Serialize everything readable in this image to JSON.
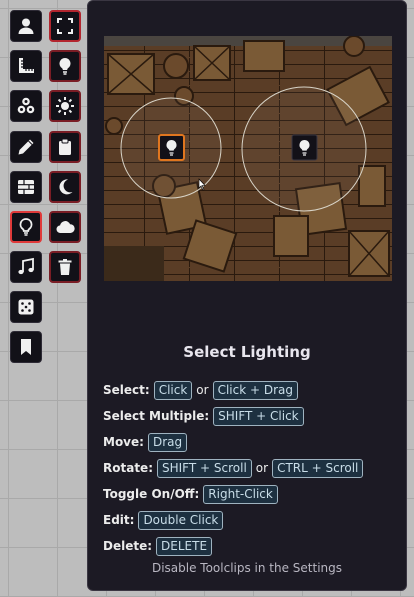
{
  "toolbar": {
    "buttons": [
      {
        "name": "token-tool",
        "icon": "user-icon"
      },
      {
        "name": "fullscreen-tool",
        "icon": "fullscreen-icon"
      },
      {
        "name": "measure-tool",
        "icon": "ruler-icon"
      },
      {
        "name": "light-sub-tool",
        "icon": "lightbulb-icon"
      },
      {
        "name": "tiles-tool",
        "icon": "shapes-icon"
      },
      {
        "name": "light-settings-tool",
        "icon": "sun-icon"
      },
      {
        "name": "drawing-tool",
        "icon": "pencil-icon"
      },
      {
        "name": "notes-tool",
        "icon": "clipboard-icon"
      },
      {
        "name": "walls-tool",
        "icon": "brick-icon"
      },
      {
        "name": "night-tool",
        "icon": "moon-icon"
      },
      {
        "name": "lighting-tool",
        "icon": "lightbulb-icon"
      },
      {
        "name": "weather-tool",
        "icon": "cloud-icon"
      },
      {
        "name": "sounds-tool",
        "icon": "music-icon"
      },
      {
        "name": "clear-tool",
        "icon": "trash-icon"
      },
      {
        "name": "tables-tool",
        "icon": "dice-icon"
      },
      {
        "name": "journal-tool",
        "icon": "bookmark-icon"
      }
    ]
  },
  "tooltip": {
    "title": "Select Lighting",
    "rows": [
      {
        "label": "Select:",
        "keys": [
          "Click",
          "Click + Drag"
        ],
        "sep": "or"
      },
      {
        "label": "Select Multiple:",
        "keys": [
          "SHIFT + Click"
        ]
      },
      {
        "label": "Move:",
        "keys": [
          "Drag"
        ]
      },
      {
        "label": "Rotate:",
        "keys": [
          "SHIFT + Scroll",
          "CTRL + Scroll"
        ],
        "sep": "or"
      },
      {
        "label": "Toggle On/Off:",
        "keys": [
          "Right-Click"
        ]
      },
      {
        "label": "Edit:",
        "keys": [
          "Double Click"
        ]
      },
      {
        "label": "Delete:",
        "keys": [
          "DELETE"
        ]
      }
    ],
    "footer": "Disable Toolclips in the Settings"
  },
  "colors": {
    "accent_active": "#e03a3a",
    "accent_sub": "#7a1d25",
    "panel_bg": "#1c1a24",
    "key_bg": "#1d3040"
  }
}
